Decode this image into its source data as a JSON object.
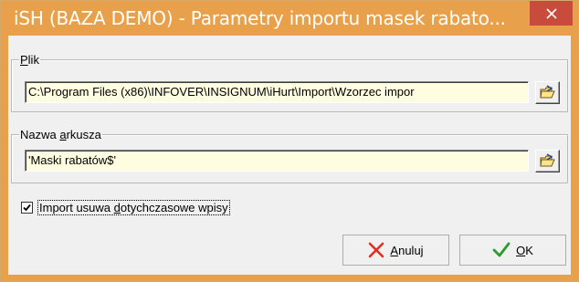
{
  "window": {
    "title": "iSH (BAZA DEMO) - Parametry importu masek rabato...",
    "close_icon": "close-icon",
    "accent_color": "#e8a04a",
    "close_color": "#c74c3c"
  },
  "file_group": {
    "label_hotkey": "P",
    "label_rest": "lik",
    "path_value": "C:\\Program Files (x86)\\INFOVER\\INSIGNUM\\iHurt\\Import\\Wzorzec impor",
    "browse_icon": "browse-folder-icon"
  },
  "sheet_group": {
    "label_pre": "Nazwa ",
    "label_hotkey": "a",
    "label_rest": "rkusza",
    "sheet_value": "'Maski rabatów$'",
    "browse_icon": "browse-folder-icon"
  },
  "options": {
    "import_removes_checked": true,
    "import_label_pre": "Import usuwa ",
    "import_label_hotkey": "d",
    "import_label_rest": "otychczasowe wpisy"
  },
  "buttons": {
    "cancel_hotkey": "A",
    "cancel_rest": "nuluj",
    "cancel_icon": "cross-icon",
    "ok_hotkey": "O",
    "ok_rest": "K",
    "ok_icon": "checkmark-icon"
  },
  "field_background": "#fffde0"
}
